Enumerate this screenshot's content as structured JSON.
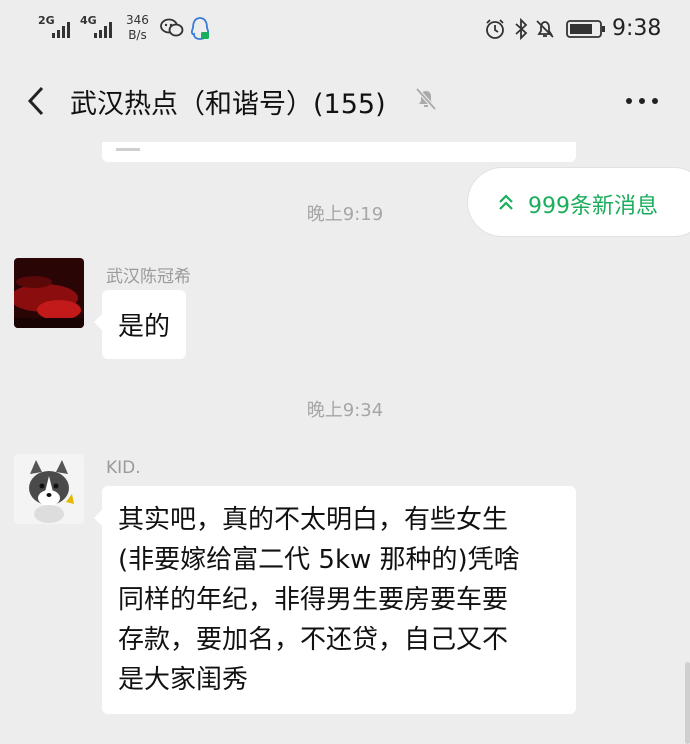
{
  "status_bar": {
    "sim1_network": "2G",
    "sim2_network": "4G",
    "speed_value": "346",
    "speed_unit": "B/s",
    "time": "9:38",
    "icons": [
      "wechat-icon",
      "qq-icon",
      "alarm-icon",
      "bluetooth-icon",
      "bell-off-icon",
      "battery-icon"
    ]
  },
  "header": {
    "title": "武汉热点（和谐号）(155)",
    "icons": [
      "back-arrow-icon",
      "muted-bell-icon",
      "more-icon"
    ]
  },
  "new_messages": {
    "label": "999条新消息"
  },
  "messages": [
    {
      "type": "timestamp",
      "text": "晚上9:19"
    },
    {
      "type": "message",
      "sender": "武汉陈冠希",
      "lines": [
        "是的"
      ]
    },
    {
      "type": "timestamp",
      "text": "晚上9:34"
    },
    {
      "type": "message",
      "sender": "KID.",
      "lines": [
        "其实吧，真的不太明白，有些女生",
        "(非要嫁给富二代 5kw 那种的)凭啥",
        "同样的年纪，非得男生要房要车要",
        "存款，要加名，不还贷，自己又不",
        "是大家闺秀"
      ]
    }
  ],
  "colors": {
    "background": "#ededed",
    "accent_green": "#1aad5b",
    "bubble": "#ffffff"
  }
}
